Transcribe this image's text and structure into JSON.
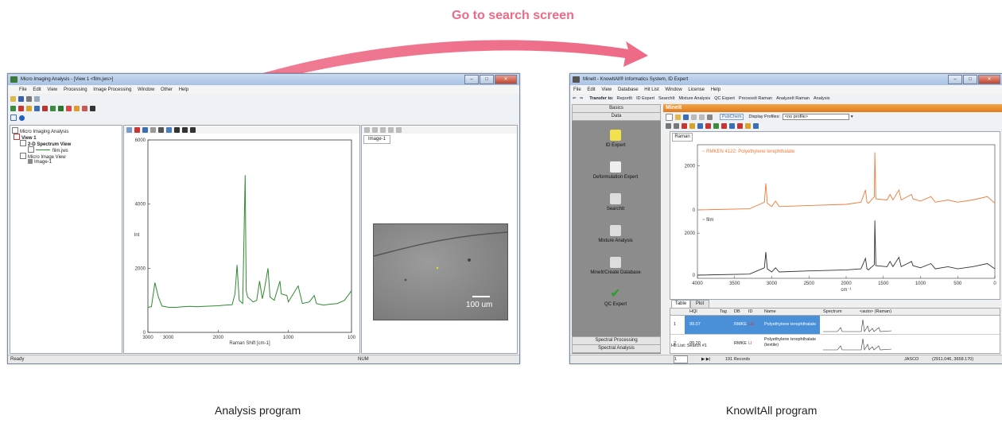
{
  "headline": "Go to search screen",
  "captions": {
    "left": "Analysis program",
    "right": "KnowItAll program"
  },
  "colors": {
    "arrow": "#ee6a86",
    "spectrum_green": "#2e8b2e",
    "spectrum_orange": "#f07a3a",
    "spectrum_black": "#333333",
    "selection_blue": "#4a90d9",
    "header_orange": "#e88a2a"
  },
  "left_window": {
    "title": "Micro Imaging Analysis - [View 1 <film.jws>]",
    "menu": [
      "File",
      "Edit",
      "View",
      "Processing",
      "Image Processing",
      "Window",
      "Other",
      "Help"
    ],
    "tree": {
      "root": "Micro Imaging Analysis",
      "view": "View 1",
      "spectrum_view": "2-D Spectrum View",
      "spectrum_file": "film.jws",
      "image_view": "Micro Image View",
      "image_item": "Image-1"
    },
    "image_tab": "Image-1",
    "scale_bar": "100 um",
    "status_left": "Ready",
    "status_right": "NUM",
    "chart_data": {
      "type": "line",
      "xlabel": "Raman Shift [cm-1]",
      "ylabel": "Int",
      "xlim": [
        3000,
        100
      ],
      "ylim": [
        0,
        6000
      ],
      "xticks": [
        "3000",
        "2000",
        "1000",
        "100"
      ],
      "extra_xtick": "3000",
      "yticks": [
        "0",
        "2000",
        "4000",
        "6000"
      ],
      "series": [
        {
          "x": [
            3000,
            2950,
            2900,
            2850,
            2800,
            2700,
            2600,
            2500,
            2400,
            2300,
            2200,
            2100,
            2000,
            1900,
            1800,
            1760,
            1730,
            1700,
            1650,
            1615,
            1600,
            1580,
            1500,
            1450,
            1410,
            1370,
            1340,
            1290,
            1260,
            1200,
            1120,
            1100,
            1020,
            1000,
            860,
            800,
            700,
            630,
            600,
            500,
            400,
            300,
            200,
            100
          ],
          "y": [
            780,
            800,
            1550,
            1100,
            820,
            780,
            780,
            800,
            810,
            800,
            810,
            820,
            830,
            850,
            860,
            1200,
            2100,
            1000,
            900,
            4900,
            1300,
            1100,
            950,
            1000,
            1600,
            1050,
            1350,
            2000,
            1100,
            1000,
            1600,
            1200,
            1150,
            950,
            1450,
            900,
            950,
            1150,
            900,
            850,
            880,
            900,
            1000,
            1300
          ]
        }
      ]
    }
  },
  "right_window": {
    "title": "MineIt - KnowItAll® Informatics System, ID Expert",
    "menu": [
      "File",
      "Edit",
      "View",
      "Database",
      "Hit List",
      "Window",
      "License",
      "Help"
    ],
    "transfer_label": "Transfer to:",
    "transfer_items": [
      "ReportIt",
      "ID Expert",
      "SearchIt",
      "Mixture Analysis",
      "QC Expert",
      "ProcessIt Raman",
      "AnalyzeIt Raman",
      "Analysis"
    ],
    "sidebar": {
      "top_tabs": [
        "Basics",
        "Data"
      ],
      "items": [
        "ID Expert",
        "Deformulation Expert",
        "SearchIt",
        "Mixture Analysis",
        "MineIt/Create Database",
        "QC Expert"
      ],
      "bottom_tabs": [
        "Spectral Processing",
        "Spectral Analysis"
      ]
    },
    "header_title": "MineIt",
    "pubchem": "PubChem",
    "display_profiles_label": "Display Profiles:",
    "display_profiles_value": "<no profile>",
    "spectrum_tab": "Raman",
    "chart_data": {
      "type": "line",
      "xlabel": "cm⁻¹",
      "xlim": [
        4000,
        0
      ],
      "xticks": [
        "4000",
        "3500",
        "3000",
        "2500",
        "2000",
        "1500",
        "1000",
        "500",
        "0"
      ],
      "top_yticks": [
        "2000",
        "0"
      ],
      "bottom_yticks": [
        "2000",
        "0"
      ],
      "series": [
        {
          "name": "~ RMKEN 4122: Polyethylene terephthalate",
          "x": [
            4000,
            3300,
            3100,
            3080,
            3060,
            3000,
            2950,
            2900,
            2500,
            2000,
            1800,
            1740,
            1720,
            1700,
            1620,
            1614,
            1600,
            1450,
            1410,
            1370,
            1290,
            1260,
            1120,
            1100,
            1000,
            860,
            800,
            630,
            500,
            300,
            100,
            0
          ],
          "y": [
            0,
            50,
            350,
            1200,
            300,
            150,
            400,
            150,
            200,
            250,
            350,
            900,
            350,
            300,
            600,
            2600,
            500,
            450,
            700,
            450,
            900,
            450,
            700,
            500,
            400,
            600,
            350,
            450,
            350,
            450,
            600,
            300
          ]
        },
        {
          "name": "~ film",
          "x": [
            4000,
            3300,
            3100,
            3080,
            3060,
            3000,
            2950,
            2900,
            2500,
            2000,
            1800,
            1740,
            1720,
            1700,
            1620,
            1614,
            1600,
            1450,
            1410,
            1370,
            1290,
            1260,
            1120,
            1100,
            1000,
            860,
            800,
            630,
            500,
            300,
            100,
            0
          ],
          "y": [
            0,
            50,
            350,
            1100,
            300,
            150,
            350,
            150,
            200,
            250,
            300,
            800,
            300,
            250,
            500,
            2600,
            450,
            400,
            650,
            400,
            850,
            400,
            650,
            450,
            350,
            550,
            300,
            400,
            300,
            400,
            550,
            300
          ]
        }
      ]
    },
    "table_tabs": [
      "Table",
      "Plot"
    ],
    "table_headers": [
      "HQI",
      "Tag",
      "DB",
      "ID",
      "Name",
      "Spectrum",
      "<auto> (Raman)"
    ],
    "table_rows": [
      {
        "num": "1",
        "hqi": "99.07",
        "db": "RMKE",
        "id": "LG",
        "name": "Polyethylene terephthalate"
      },
      {
        "num": "2",
        "hqi": "99.20",
        "db": "RMKE",
        "id": "LI",
        "name": "Polyethylene terephthalate (textile)"
      }
    ],
    "hitlist_label": "Hit List: Search #1",
    "page_value": "1",
    "records": "191 Records",
    "status_company": "JASCO",
    "status_coords": "(2911.046, 3658.170)"
  }
}
